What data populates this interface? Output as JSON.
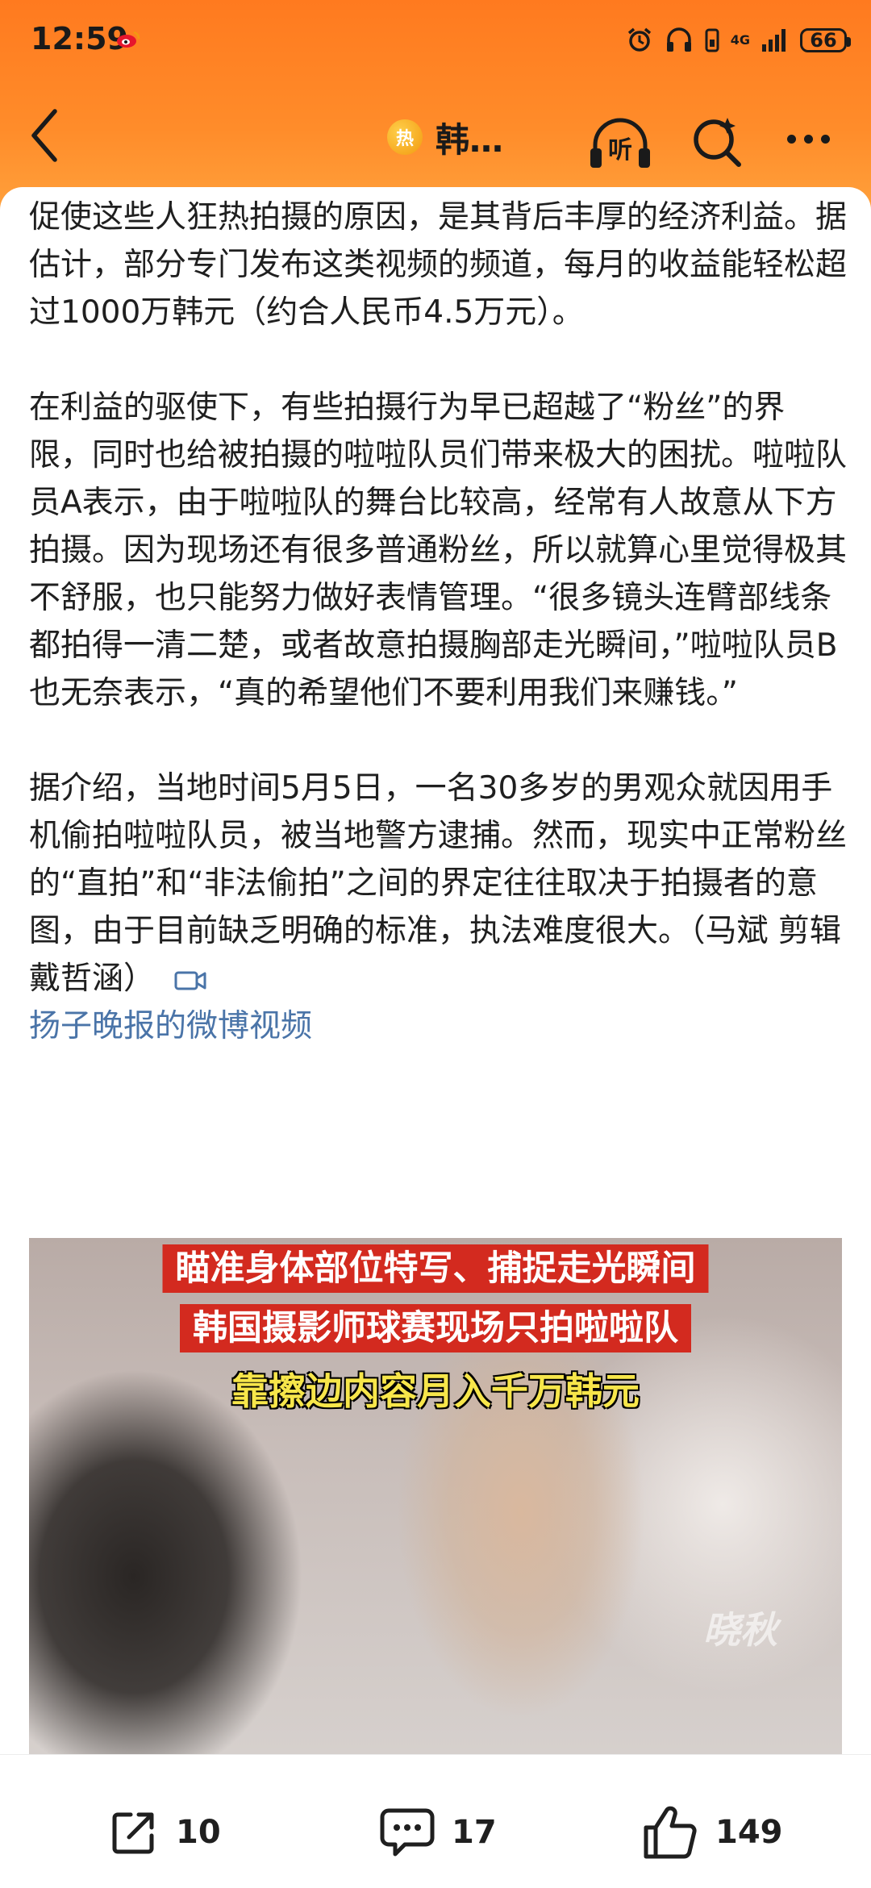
{
  "status_bar": {
    "time": "12:59",
    "network": "4G",
    "battery": "66"
  },
  "nav": {
    "hot_badge": "热",
    "title": "韩…",
    "listen_label": "听"
  },
  "article": {
    "paragraphs": [
      "促使这些人狂热拍摄的原因，是其背后丰厚的经济利益。据估计，部分专门发布这类视频的频道，每月的收益能轻松超过1000万韩元（约合人民币4.5万元）。",
      "在利益的驱使下，有些拍摄行为早已超越了“粉丝”的界限，同时也给被拍摄的啦啦队员们带来极大的困扰。啦啦队员A表示，由于啦啦队的舞台比较高，经常有人故意从下方拍摄。因为现场还有很多普通粉丝，所以就算心里觉得极其不舒服，也只能努力做好表情管理。“很多镜头连臂部线条都拍得一清二楚，或者故意拍摄胸部走光瞬间，”啦啦队员B也无奈表示，“真的希望他们不要利用我们来赚钱。”",
      "据介绍，当地时间5月5日，一名30多岁的男观众就因用手机偷拍啦啦队员，被当地警方逮捕。然而，现实中正常粉丝的“直拍”和“非法偷拍”之间的界定往往取决于拍摄者的意图，由于目前缺乏明确的标准，执法难度很大。（马斌 剪辑 戴哲涵）"
    ],
    "video_link": "扬子晚报的微博视频"
  },
  "video": {
    "caption_line1": "瞄准身体部位特写、捕捉走光瞬间",
    "caption_line2": "韩国摄影师球赛现场只拍啦啦队",
    "caption_line3": "靠擦边内容月入千万韩元",
    "watermark": "晓秋"
  },
  "actions": {
    "share_count": "10",
    "comment_count": "17",
    "like_count": "149"
  },
  "colors": {
    "header_orange": "#ff7a1f",
    "link_blue": "#4a74a8",
    "caption_red": "#d32a1f",
    "caption_yellow": "#f7e64a"
  }
}
